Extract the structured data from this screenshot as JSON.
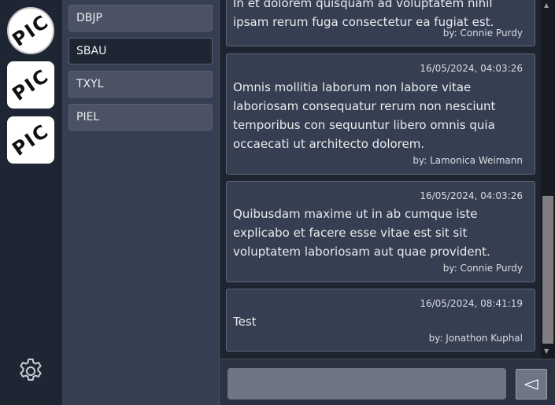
{
  "servers": [
    {
      "icon": "pic-avatar",
      "label": "PIC"
    },
    {
      "icon": "pic-avatar",
      "label": "PIC"
    },
    {
      "icon": "pic-avatar",
      "label": "PIC"
    }
  ],
  "settings_icon": "gear-icon",
  "channels": [
    {
      "label": "DBJP"
    },
    {
      "label": "SBAU"
    },
    {
      "label": "TXYL"
    },
    {
      "label": "PIEL"
    }
  ],
  "messages": [
    {
      "timestamp": "",
      "text": "In et dolorem quisquam ad voluptatem nihil ipsam rerum fuga consectetur ea fugiat est.",
      "author": "by: Connie Purdy"
    },
    {
      "timestamp": "16/05/2024, 04:03:26",
      "text": "Omnis mollitia laborum non labore vitae laboriosam consequatur rerum non nesciunt temporibus con sequuntur libero omnis quia occaecati ut architecto dolorem.",
      "author": "by: Lamonica Weimann"
    },
    {
      "timestamp": "16/05/2024, 04:03:26",
      "text": "Quibusdam maxime ut in ab cumque iste explicabo et facere esse vitae est sit sit voluptatem laboriosam aut quae provident.",
      "author": "by: Connie Purdy"
    },
    {
      "timestamp": "16/05/2024, 08:41:19",
      "text": "Test",
      "author": "by: Jonathon Kuphal"
    }
  ],
  "composer": {
    "placeholder": "",
    "send_icon": "send-icon"
  },
  "colors": {
    "rail_bg": "#1f2633",
    "channel_bg": "#363f51",
    "active_channel_bg": "#1f2633",
    "message_bg": "#363f51"
  }
}
